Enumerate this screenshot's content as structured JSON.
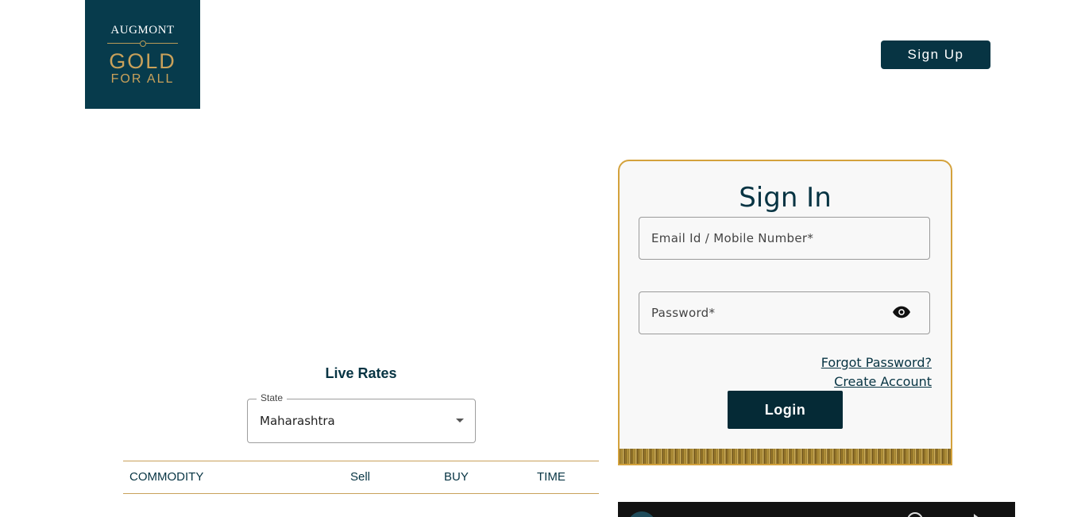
{
  "logo": {
    "brand": "AUGMONT",
    "line1": "GOLD",
    "line2": "FOR ALL"
  },
  "header": {
    "signup_label": "Sign Up"
  },
  "live_rates": {
    "title": "Live Rates",
    "state_label": "State",
    "state_value": "Maharashtra",
    "columns": [
      "COMMODITY",
      "Sell",
      "BUY",
      "TIME"
    ]
  },
  "signin": {
    "title": "Sign In",
    "email_placeholder": "Email Id / Mobile Number*",
    "password_placeholder": "Password*",
    "forgot_label": "Forgot Password?",
    "create_label": "Create Account",
    "login_label": "Login"
  },
  "colors": {
    "brand_dark": "#073b4c",
    "gold_accent": "#d4a23c"
  }
}
